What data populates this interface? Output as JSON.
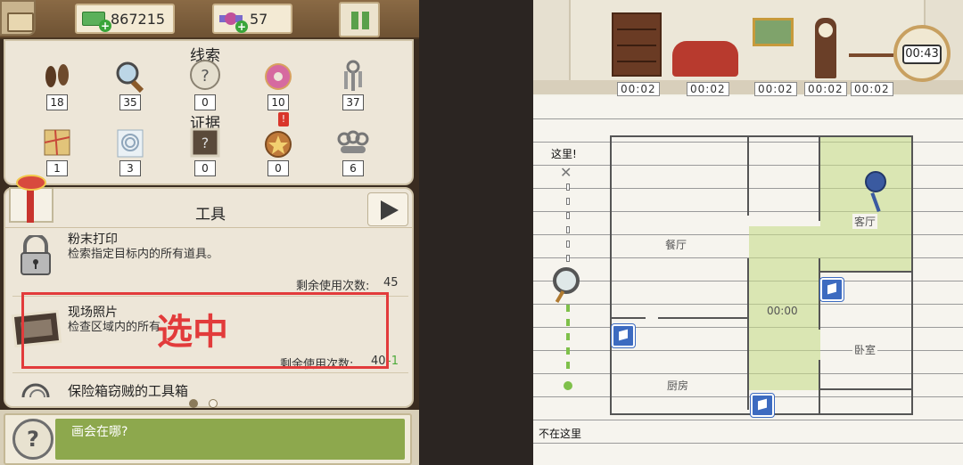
{
  "topbar": {
    "money": "867215",
    "candy": "57"
  },
  "clues": {
    "title": "线索",
    "items": [
      {
        "icon": "footprint-icon",
        "count": "18"
      },
      {
        "icon": "magnifier-icon",
        "count": "35"
      },
      {
        "icon": "question-icon",
        "count": "0"
      },
      {
        "icon": "donut-icon",
        "count": "10"
      },
      {
        "icon": "keys-icon",
        "count": "37"
      }
    ]
  },
  "evidence": {
    "title": "证据",
    "badge": "!",
    "items": [
      {
        "icon": "map-icon",
        "count": "1"
      },
      {
        "icon": "fingerprint-icon",
        "count": "3"
      },
      {
        "icon": "photo-question-icon",
        "count": "0"
      },
      {
        "icon": "police-badge-icon",
        "count": "0"
      },
      {
        "icon": "brass-knuckles-icon",
        "count": "6"
      }
    ]
  },
  "tools": {
    "title": "工具",
    "items": [
      {
        "name": "粉末打印",
        "desc": "检索指定目标内的所有道具。",
        "uses_label": "剩余使用次数:",
        "uses": "45"
      },
      {
        "name": "现场照片",
        "desc": "检查区域内的所有",
        "uses_label": "剩余使用次数:",
        "uses": "40",
        "uses_delta": "-1"
      },
      {
        "name": "保险箱窃贼的工具箱"
      }
    ]
  },
  "annotation": {
    "label": "选中"
  },
  "question": {
    "text": "画会在哪?"
  },
  "scene": {
    "timer": "00:43",
    "room_timers": [
      "00:02",
      "00:02",
      "00:02",
      "00:02",
      "00:02"
    ]
  },
  "map": {
    "here": "这里!",
    "not_here": "不在这里",
    "rooms": {
      "dining": "餐厅",
      "living": "客厅",
      "bedroom": "卧室",
      "kitchen": "厨房"
    },
    "center_timer": "00:00"
  },
  "colors": {
    "accent_red": "#e23b3b",
    "zone_green": "#c8dc8c",
    "box_blue": "#3d6bc0",
    "question_green": "#8da84d"
  }
}
